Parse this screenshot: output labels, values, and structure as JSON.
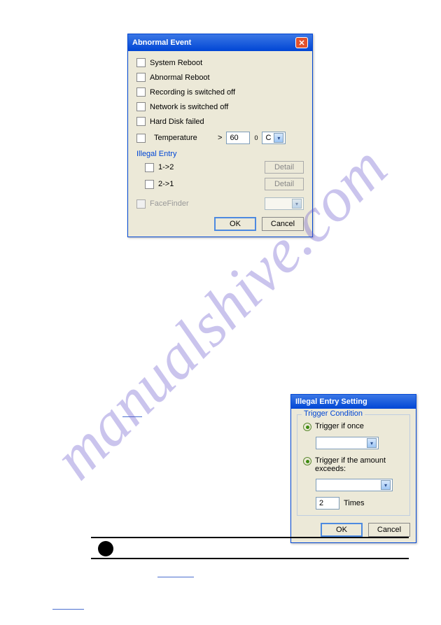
{
  "watermark": "manualshive.com",
  "dialog1": {
    "title": "Abnormal Event",
    "options": {
      "system_reboot": "System Reboot",
      "abnormal_reboot": "Abnormal Reboot",
      "recording_off": "Recording is switched off",
      "network_off": "Network is switched off",
      "hdd_failed": "Hard Disk failed",
      "temperature": "Temperature",
      "gt": ">",
      "temp_value": "60",
      "degree": "0",
      "unit": "C"
    },
    "illegal_entry": {
      "title": "Illegal Entry",
      "opt1": "1->2",
      "opt2": "2->1",
      "detail": "Detail"
    },
    "facefinder": "FaceFinder",
    "buttons": {
      "ok": "OK",
      "cancel": "Cancel"
    }
  },
  "dialog2": {
    "title": "Illegal Entry Setting",
    "group_title": "Trigger Condition",
    "opt1": "Trigger if once",
    "opt2": "Trigger if the amount exceeds:",
    "times_value": "2",
    "times_label": "Times",
    "buttons": {
      "ok": "OK",
      "cancel": "Cancel"
    }
  }
}
